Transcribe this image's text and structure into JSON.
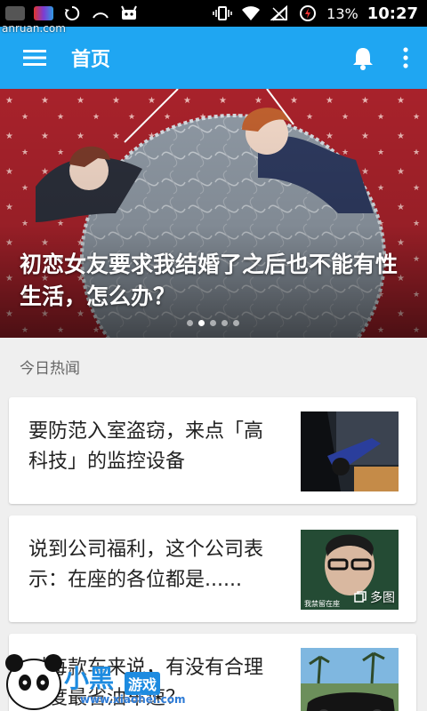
{
  "status_bar": {
    "battery_percent": "13%",
    "time": "10:27"
  },
  "watermark_top": "anruan.com",
  "app_bar": {
    "title": "首页"
  },
  "banner": {
    "title": "初恋女友要求我结婚了之后也不能有性生活，怎么办？",
    "dots": 5,
    "active_dot": 1
  },
  "section": {
    "title": "今日热闻"
  },
  "cards": [
    {
      "title": "要防范入室盗窃，来点「高科技」的监控设备"
    },
    {
      "title": "说到公司福利，这个公司表示：在座的各位都是......",
      "badge": "多图",
      "thumb_caption": "我禁留在座"
    },
    {
      "title": "对每款车来说，有没有合理速度最省油车速？"
    }
  ],
  "watermark_bottom": {
    "brand": "小黑",
    "tag": "游戏",
    "url": "www.xiaohei.com"
  }
}
